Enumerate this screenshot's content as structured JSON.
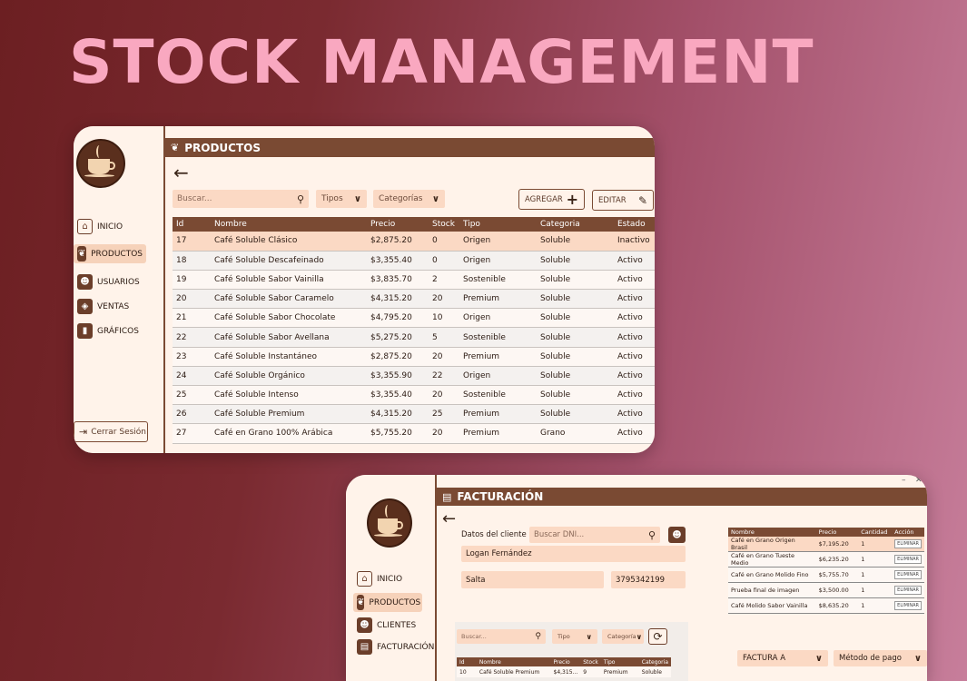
{
  "hero": {
    "title": "STOCK MANAGEMENT"
  },
  "win1": {
    "header": "PRODUCTOS",
    "search_placeholder": "Buscar...",
    "filter_tipos": "Tipos",
    "filter_categorias": "Categorías",
    "add_button": "AGREGAR",
    "edit_button": "EDITAR",
    "logout": "Cerrar Sesión",
    "nav": [
      {
        "label": "INICIO",
        "icon": "home-icon"
      },
      {
        "label": "PRODUCTOS",
        "icon": "coffee-beans-icon"
      },
      {
        "label": "USUARIOS",
        "icon": "users-icon"
      },
      {
        "label": "VENTAS",
        "icon": "tag-icon"
      },
      {
        "label": "GRÁFICOS",
        "icon": "chart-icon"
      }
    ],
    "columns": [
      "Id",
      "Nombre",
      "Precio",
      "Stock",
      "Tipo",
      "Categoria",
      "Estado"
    ],
    "rows": [
      [
        "17",
        "Café Soluble Clásico",
        "$2,875.20",
        "0",
        "Origen",
        "Soluble",
        "Inactivo"
      ],
      [
        "18",
        "Café Soluble Descafeinado",
        "$3,355.40",
        "0",
        "Origen",
        "Soluble",
        "Activo"
      ],
      [
        "19",
        "Café Soluble Sabor Vainilla",
        "$3,835.70",
        "2",
        "Sostenible",
        "Soluble",
        "Activo"
      ],
      [
        "20",
        "Café Soluble Sabor Caramelo",
        "$4,315.20",
        "20",
        "Premium",
        "Soluble",
        "Activo"
      ],
      [
        "21",
        "Café Soluble Sabor Chocolate",
        "$4,795.20",
        "10",
        "Origen",
        "Soluble",
        "Activo"
      ],
      [
        "22",
        "Café Soluble Sabor Avellana",
        "$5,275.20",
        "5",
        "Sostenible",
        "Soluble",
        "Activo"
      ],
      [
        "23",
        "Café Soluble Instantáneo",
        "$2,875.20",
        "20",
        "Premium",
        "Soluble",
        "Activo"
      ],
      [
        "24",
        "Café Soluble Orgánico",
        "$3,355.90",
        "22",
        "Origen",
        "Soluble",
        "Activo"
      ],
      [
        "25",
        "Café Soluble Intenso",
        "$3,355.40",
        "20",
        "Sostenible",
        "Soluble",
        "Activo"
      ],
      [
        "26",
        "Café Soluble Premium",
        "$4,315.20",
        "25",
        "Premium",
        "Soluble",
        "Activo"
      ],
      [
        "27",
        "Café en Grano 100% Arábica",
        "$5,755.20",
        "20",
        "Premium",
        "Grano",
        "Activo"
      ]
    ]
  },
  "win2": {
    "header": "FACTURACIÓN",
    "client_label": "Datos del cliente",
    "dni_placeholder": "Buscar DNI...",
    "client_name": "Logan Fernández",
    "client_city": "Salta",
    "client_phone": "3795342199",
    "nav": [
      {
        "label": "INICIO"
      },
      {
        "label": "PRODUCTOS"
      },
      {
        "label": "CLIENTES"
      },
      {
        "label": "FACTURACIÓN"
      }
    ],
    "cart_columns": [
      "Nombre",
      "Precio",
      "Cantidad",
      "Acción"
    ],
    "cart_rows": [
      [
        "Café en Grano Origen Brasil",
        "$7,195.20",
        "1",
        "ELIMINAR"
      ],
      [
        "Café en Grano Tueste Medio",
        "$6,235.20",
        "1",
        "ELIMINAR"
      ],
      [
        "Café en Grano Molido Fino",
        "$5,755.70",
        "1",
        "ELIMINAR"
      ],
      [
        "Prueba final de imagen",
        "$3,500.00",
        "1",
        "ELIMINAR"
      ],
      [
        "Café Molido Sabor Vainilla",
        "$8,635.20",
        "1",
        "ELIMINAR"
      ]
    ],
    "search_placeholder": "Buscar...",
    "filter_tipo": "Tipo",
    "filter_categoria": "Categoría",
    "invoice_type": "FACTURA A",
    "payment_method": "Método de pago",
    "prod_columns": [
      "Id",
      "Nombre",
      "Precio",
      "Stock",
      "Tipo",
      "Categoria"
    ],
    "prod_row": [
      "10",
      "Café Soluble Premium",
      "$4,315...",
      "9",
      "Premium",
      "Soluble"
    ]
  }
}
